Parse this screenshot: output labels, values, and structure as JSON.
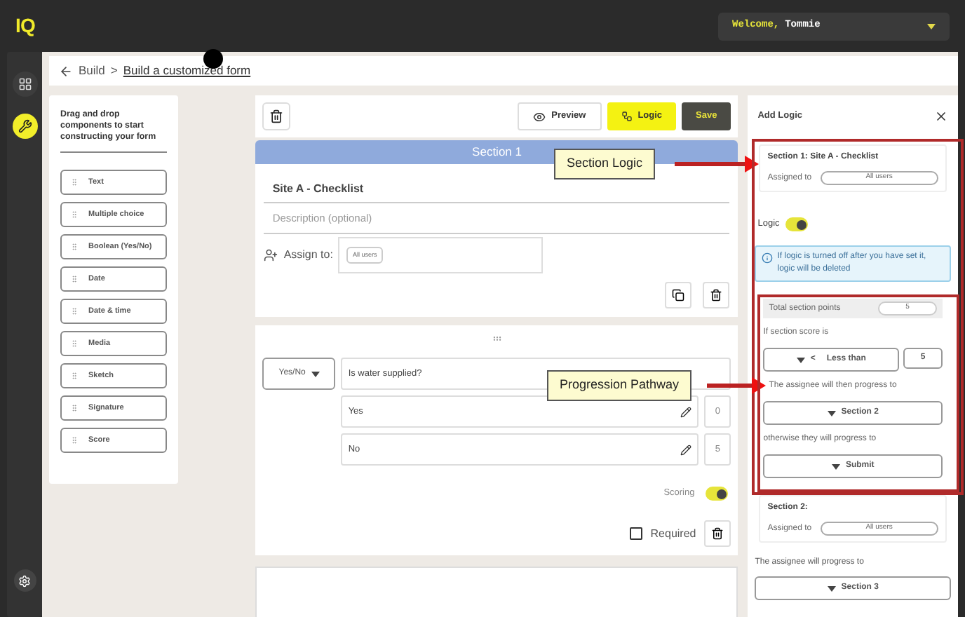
{
  "topbar": {
    "logo": "IQ",
    "welcome": "Welcome,",
    "user": "Tommie"
  },
  "sidebar": {
    "items": [
      {
        "kind": "dashboard",
        "selected": false
      },
      {
        "kind": "build",
        "selected": true
      }
    ]
  },
  "breadcrumb": {
    "parent": "Build",
    "separator": ">",
    "current": "Build a customized form"
  },
  "palette": {
    "intro": "Drag and drop components to start constructing your form",
    "items": [
      "Text",
      "Multiple choice",
      "Boolean (Yes/No)",
      "Date",
      "Date & time",
      "Media",
      "Sketch",
      "Signature",
      "Score"
    ]
  },
  "toolbar": {
    "buttons": [
      {
        "kind": "outline",
        "label": "Preview",
        "selected": false
      },
      {
        "kind": "logic",
        "label": "Logic",
        "selected": true
      },
      {
        "kind": "save",
        "label": "Save"
      }
    ]
  },
  "section": {
    "header": "Section 1",
    "title": "Site A - Checklist",
    "description_placeholder": "Description (optional)",
    "assign_label": "Assign to:",
    "assignee": "All users"
  },
  "question": {
    "type": "Yes/No",
    "text": "Is water supplied?",
    "options": [
      {
        "label": "Yes",
        "score": "0"
      },
      {
        "label": "No",
        "score": "5"
      }
    ],
    "scoring_label": "Scoring",
    "scoring_on": true,
    "required_label": "Required",
    "required_checked": false
  },
  "logic_panel": {
    "title": "Add Logic",
    "section_title": "Section 1: Site A - Checklist",
    "assigned_label": "Assigned to",
    "assigned_value": "All users",
    "logic_label": "Logic",
    "logic_on": true,
    "info": "If logic is turned off after you have set it, logic will be deleted",
    "points_label": "Total section points",
    "points_value": "5",
    "score_label": "If section score is",
    "operator": "<",
    "operator_label": "Less than",
    "threshold": "5",
    "then_label": "The assignee will then progress to",
    "then_target": "Section 2",
    "otherwise_label": "otherwise they will progress to",
    "otherwise_target": "Submit",
    "next_section": {
      "title": "Section 2:",
      "assigned_label": "Assigned to",
      "assigned_value": "All users",
      "progress_label": "The assignee will progress to",
      "target": "Section 3"
    }
  },
  "annotations": [
    {
      "kind": "section",
      "label": "Section Logic"
    },
    {
      "kind": "pathway",
      "label": "Progression Pathway"
    }
  ]
}
